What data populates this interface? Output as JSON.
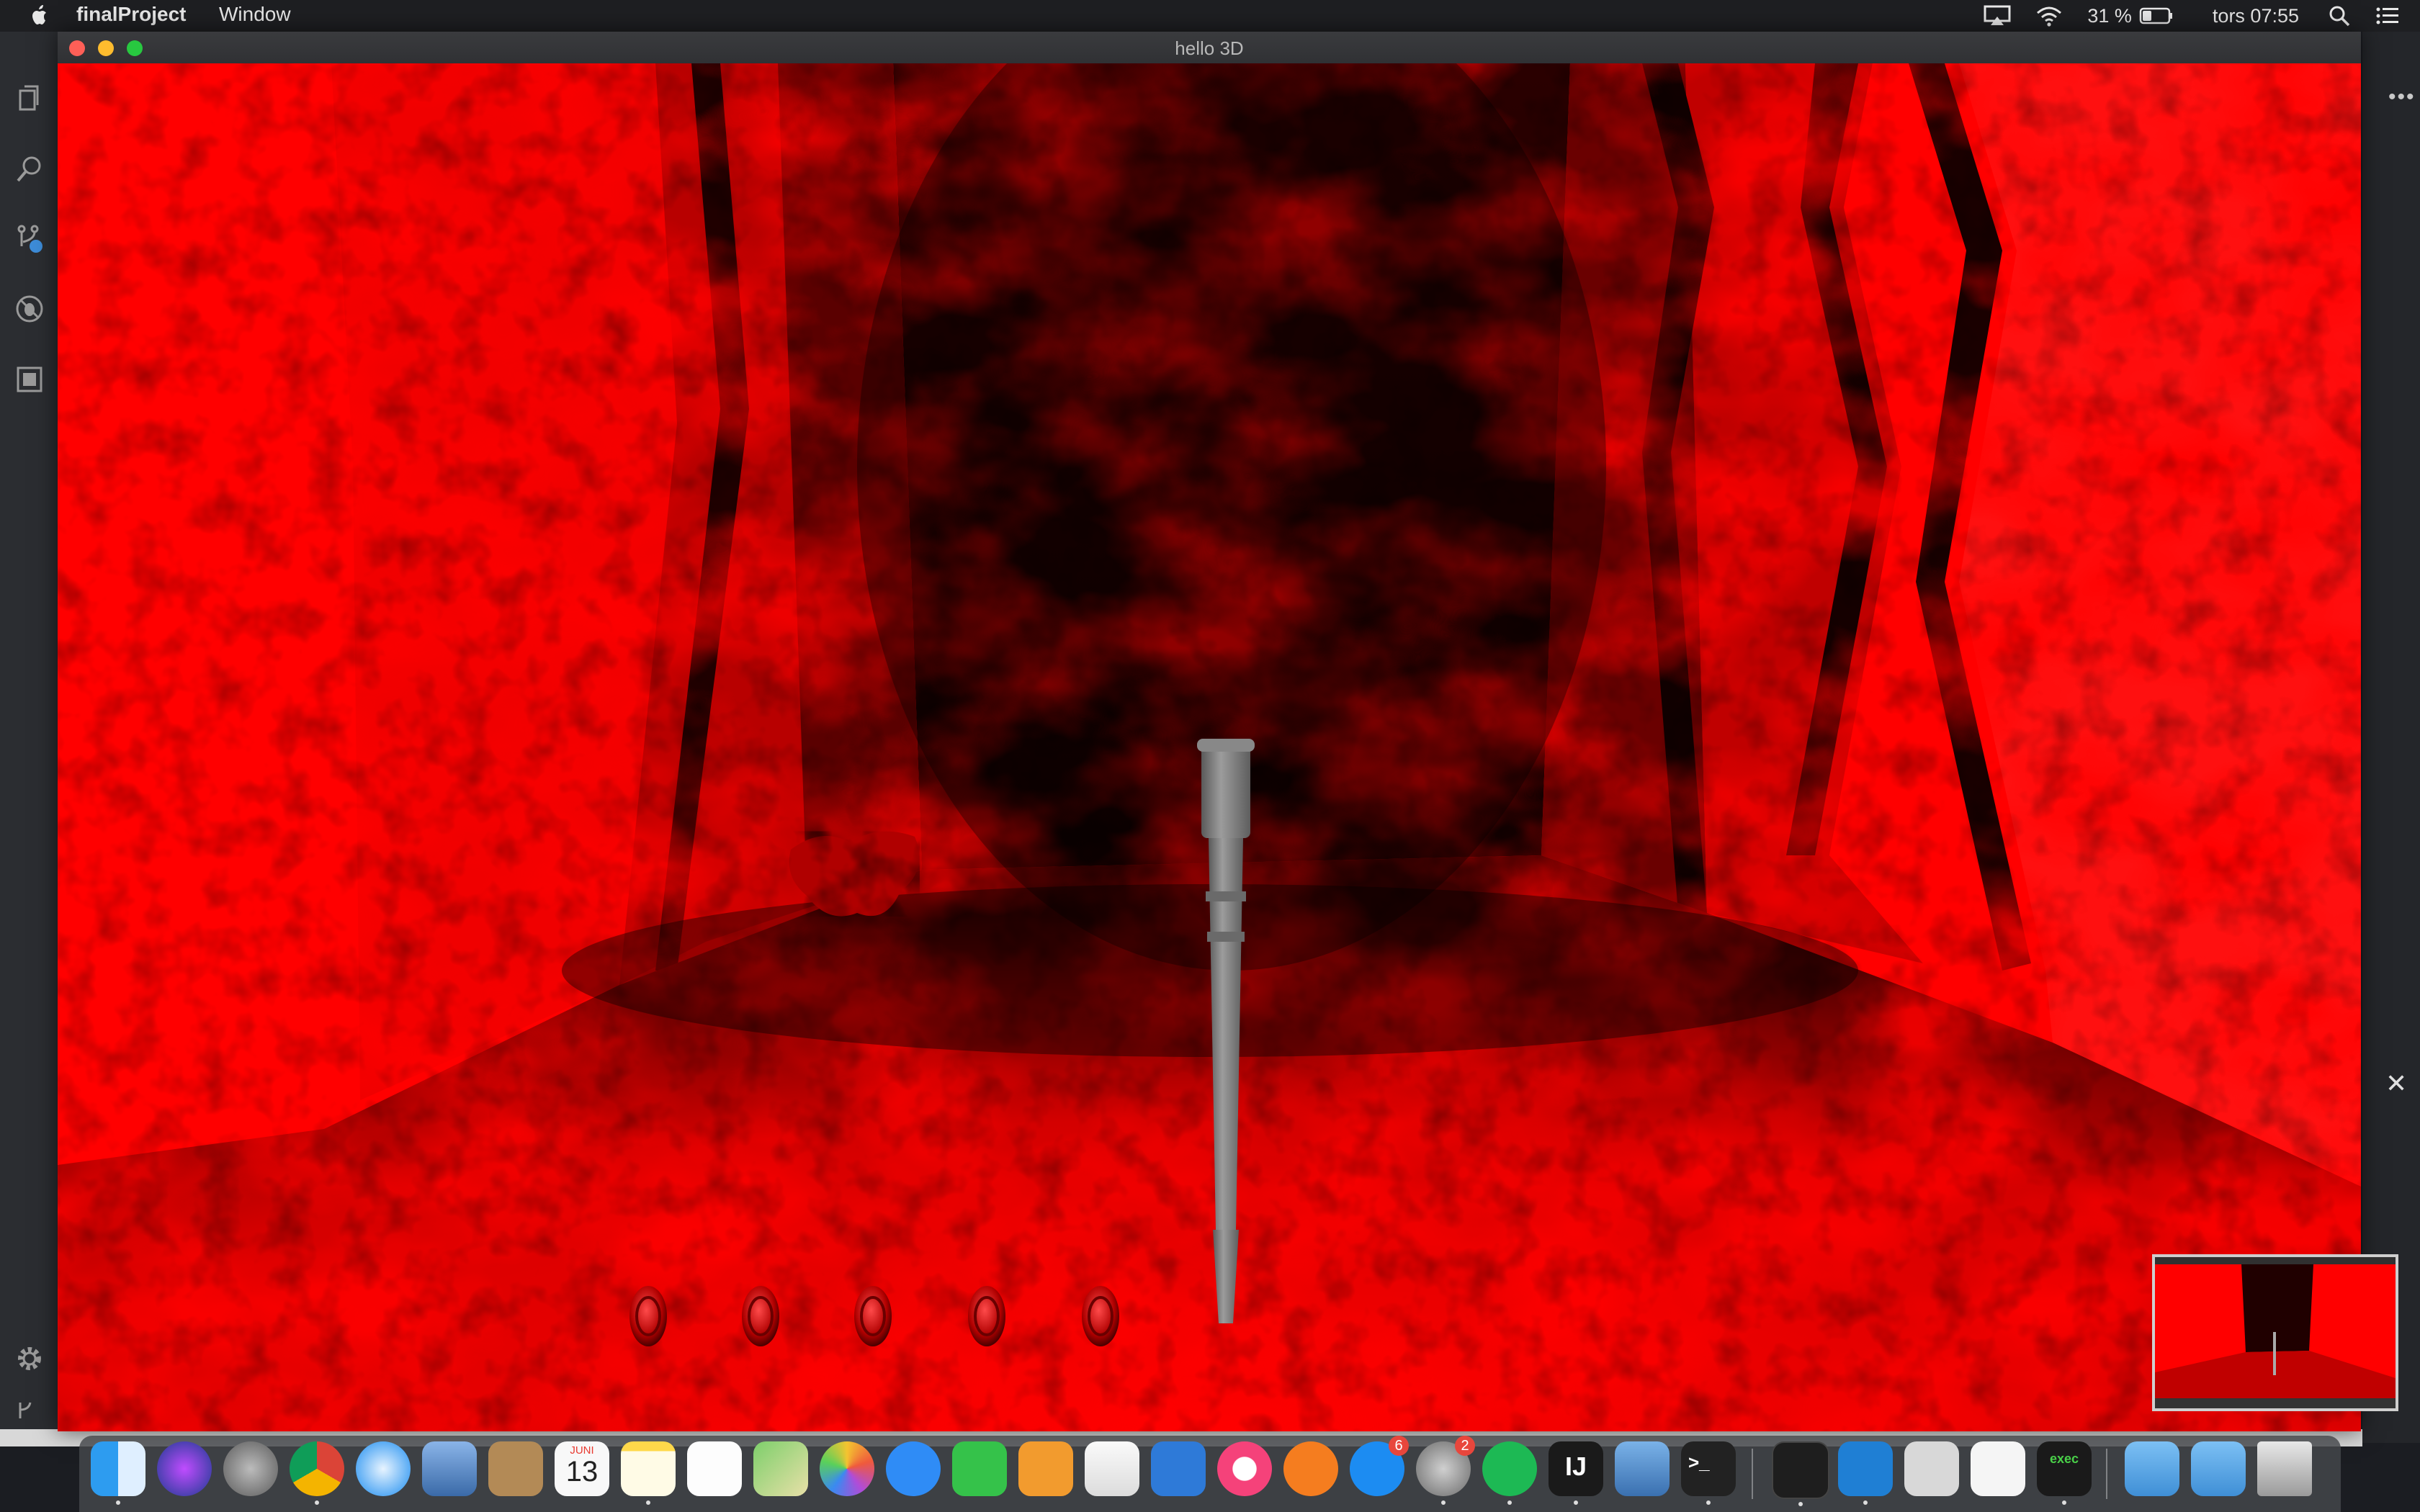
{
  "menubar": {
    "app_name": "finalProject",
    "menu_window": "Window",
    "battery": "31 %",
    "clock": "tors 07:55"
  },
  "window": {
    "title": "hello 3D"
  },
  "scene": {
    "wall_color": "#ff0000",
    "shadow_color": "#200000",
    "health_orb_count": 5
  },
  "dock": {
    "calendar_month": "JUNI",
    "calendar_day": "13",
    "appstore_badge": "6",
    "sysprefs_badge": "2",
    "terminal_text": ">_",
    "intellij_text": "IJ",
    "exec_text": "exec"
  }
}
